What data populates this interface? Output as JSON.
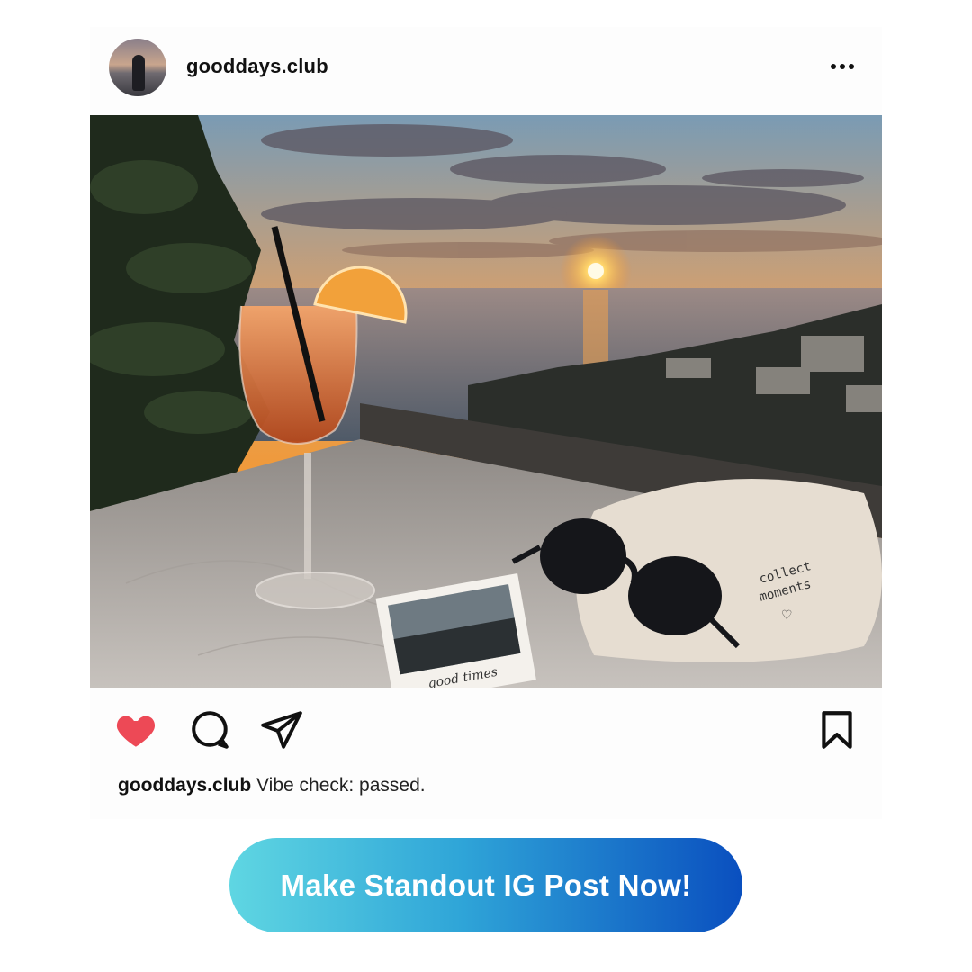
{
  "post": {
    "username": "gooddays.club",
    "caption_user": "gooddays.club",
    "caption_text": "Vibe check: passed.",
    "photo": {
      "polaroid_text": "good times",
      "bag_text_line1": "collect",
      "bag_text_line2": "moments",
      "bag_heart": "♡"
    }
  },
  "icons": {
    "more": "more-options-icon",
    "like": "heart-icon",
    "comment": "comment-icon",
    "share": "send-icon",
    "save": "bookmark-icon"
  },
  "colors": {
    "like_red": "#ed4956",
    "cta_start": "#5fd6e2",
    "cta_end": "#0a4fbf"
  },
  "cta": {
    "label": "Make Standout IG Post Now!"
  }
}
